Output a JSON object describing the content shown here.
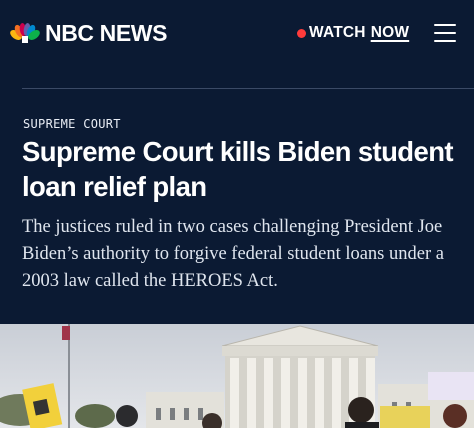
{
  "header": {
    "brand": "NBC NEWS",
    "watch_label": "WATCH",
    "now_label": "NOW",
    "icons": [
      "nbc-peacock-icon",
      "live-dot-icon",
      "hamburger-menu-icon"
    ],
    "live_dot_color": "#ff3b3b"
  },
  "article": {
    "section": "SUPREME COURT",
    "headline": "Supreme Court kills Biden student loan relief plan",
    "dek": "The justices ruled in two cases challenging President Joe Biden’s authority to forgive federal student loans under a 2003 law called the HEROES Act.",
    "photo": "supreme-court-exterior-protest-image"
  },
  "colors": {
    "background": "#0b1a33",
    "text": "#ffffff"
  }
}
